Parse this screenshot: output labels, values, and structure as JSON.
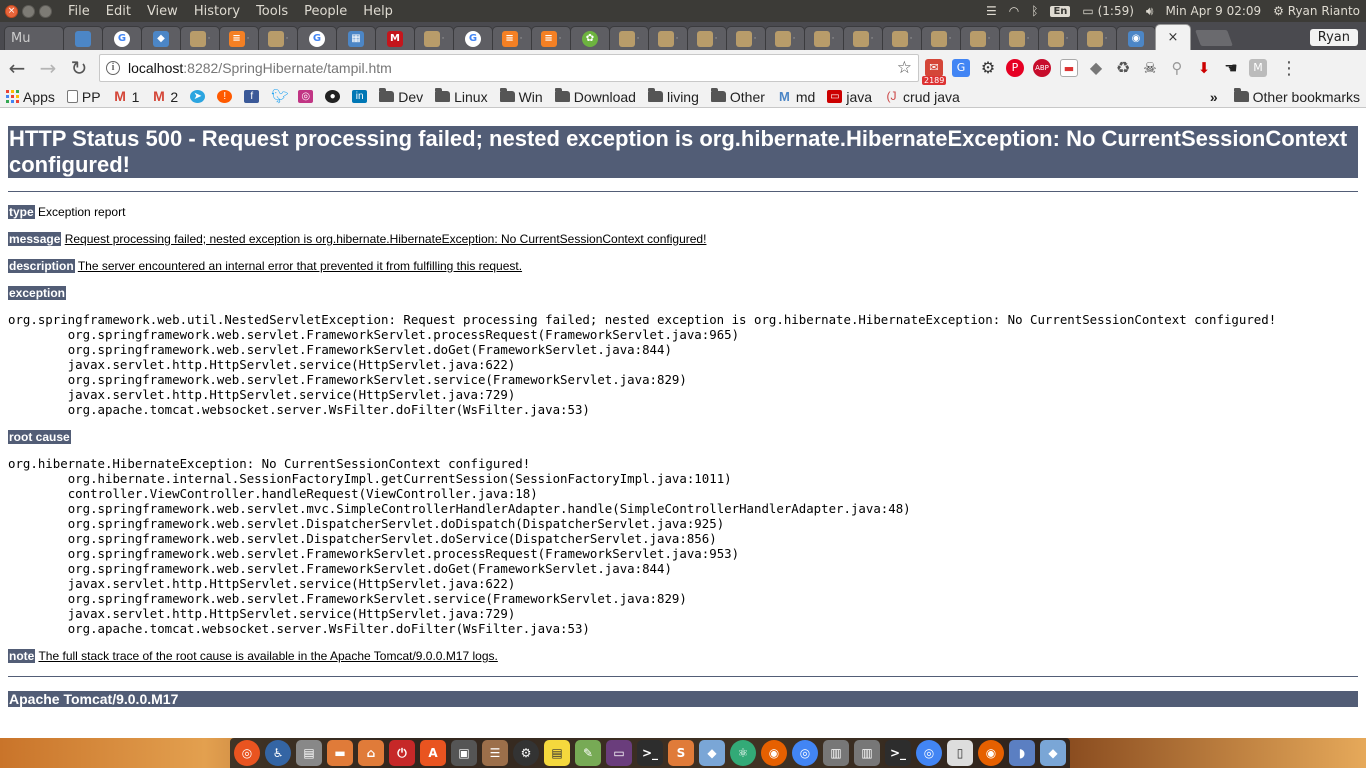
{
  "top_panel": {
    "menus": [
      "File",
      "Edit",
      "View",
      "History",
      "Tools",
      "People",
      "Help"
    ],
    "keyboard": "En",
    "battery": "(1:59)",
    "clock": "Min Apr  9 02:09",
    "user": "Ryan Rianto"
  },
  "tabs": {
    "first_title": "Mu",
    "profile": "Ryan"
  },
  "toolbar": {
    "url_host": "localhost",
    "url_path": ":8282/SpringHibernate/tampil.htm",
    "gmail_count": "2189",
    "abp": "ABP"
  },
  "bookmarks": {
    "apps": "Apps",
    "items": [
      "PP",
      "1",
      "2",
      "Dev",
      "Linux",
      "Win",
      "Download",
      "living",
      "Other",
      "md",
      "java",
      "crud java"
    ],
    "other": "Other bookmarks"
  },
  "error_page": {
    "title": "HTTP Status 500 - Request processing failed; nested exception is org.hibernate.HibernateException: No CurrentSessionContext configured!",
    "type_label": "type",
    "type_value": "Exception report",
    "message_label": "message",
    "message_value": "Request processing failed; nested exception is org.hibernate.HibernateException: No CurrentSessionContext configured!",
    "description_label": "description",
    "description_value": "The server encountered an internal error that prevented it from fulfilling this request.",
    "exception_label": "exception",
    "exception_trace": "org.springframework.web.util.NestedServletException: Request processing failed; nested exception is org.hibernate.HibernateException: No CurrentSessionContext configured!\n\torg.springframework.web.servlet.FrameworkServlet.processRequest(FrameworkServlet.java:965)\n\torg.springframework.web.servlet.FrameworkServlet.doGet(FrameworkServlet.java:844)\n\tjavax.servlet.http.HttpServlet.service(HttpServlet.java:622)\n\torg.springframework.web.servlet.FrameworkServlet.service(FrameworkServlet.java:829)\n\tjavax.servlet.http.HttpServlet.service(HttpServlet.java:729)\n\torg.apache.tomcat.websocket.server.WsFilter.doFilter(WsFilter.java:53)",
    "root_cause_label": "root cause",
    "root_cause_trace": "org.hibernate.HibernateException: No CurrentSessionContext configured!\n\torg.hibernate.internal.SessionFactoryImpl.getCurrentSession(SessionFactoryImpl.java:1011)\n\tcontroller.ViewController.handleRequest(ViewController.java:18)\n\torg.springframework.web.servlet.mvc.SimpleControllerHandlerAdapter.handle(SimpleControllerHandlerAdapter.java:48)\n\torg.springframework.web.servlet.DispatcherServlet.doDispatch(DispatcherServlet.java:925)\n\torg.springframework.web.servlet.DispatcherServlet.doService(DispatcherServlet.java:856)\n\torg.springframework.web.servlet.FrameworkServlet.processRequest(FrameworkServlet.java:953)\n\torg.springframework.web.servlet.FrameworkServlet.doGet(FrameworkServlet.java:844)\n\tjavax.servlet.http.HttpServlet.service(HttpServlet.java:622)\n\torg.springframework.web.servlet.FrameworkServlet.service(FrameworkServlet.java:829)\n\tjavax.servlet.http.HttpServlet.service(HttpServlet.java:729)\n\torg.apache.tomcat.websocket.server.WsFilter.doFilter(WsFilter.java:53)",
    "note_label": "note",
    "note_value": "The full stack trace of the root cause is available in the Apache Tomcat/9.0.0.M17 logs.",
    "footer": "Apache Tomcat/9.0.0.M17"
  }
}
